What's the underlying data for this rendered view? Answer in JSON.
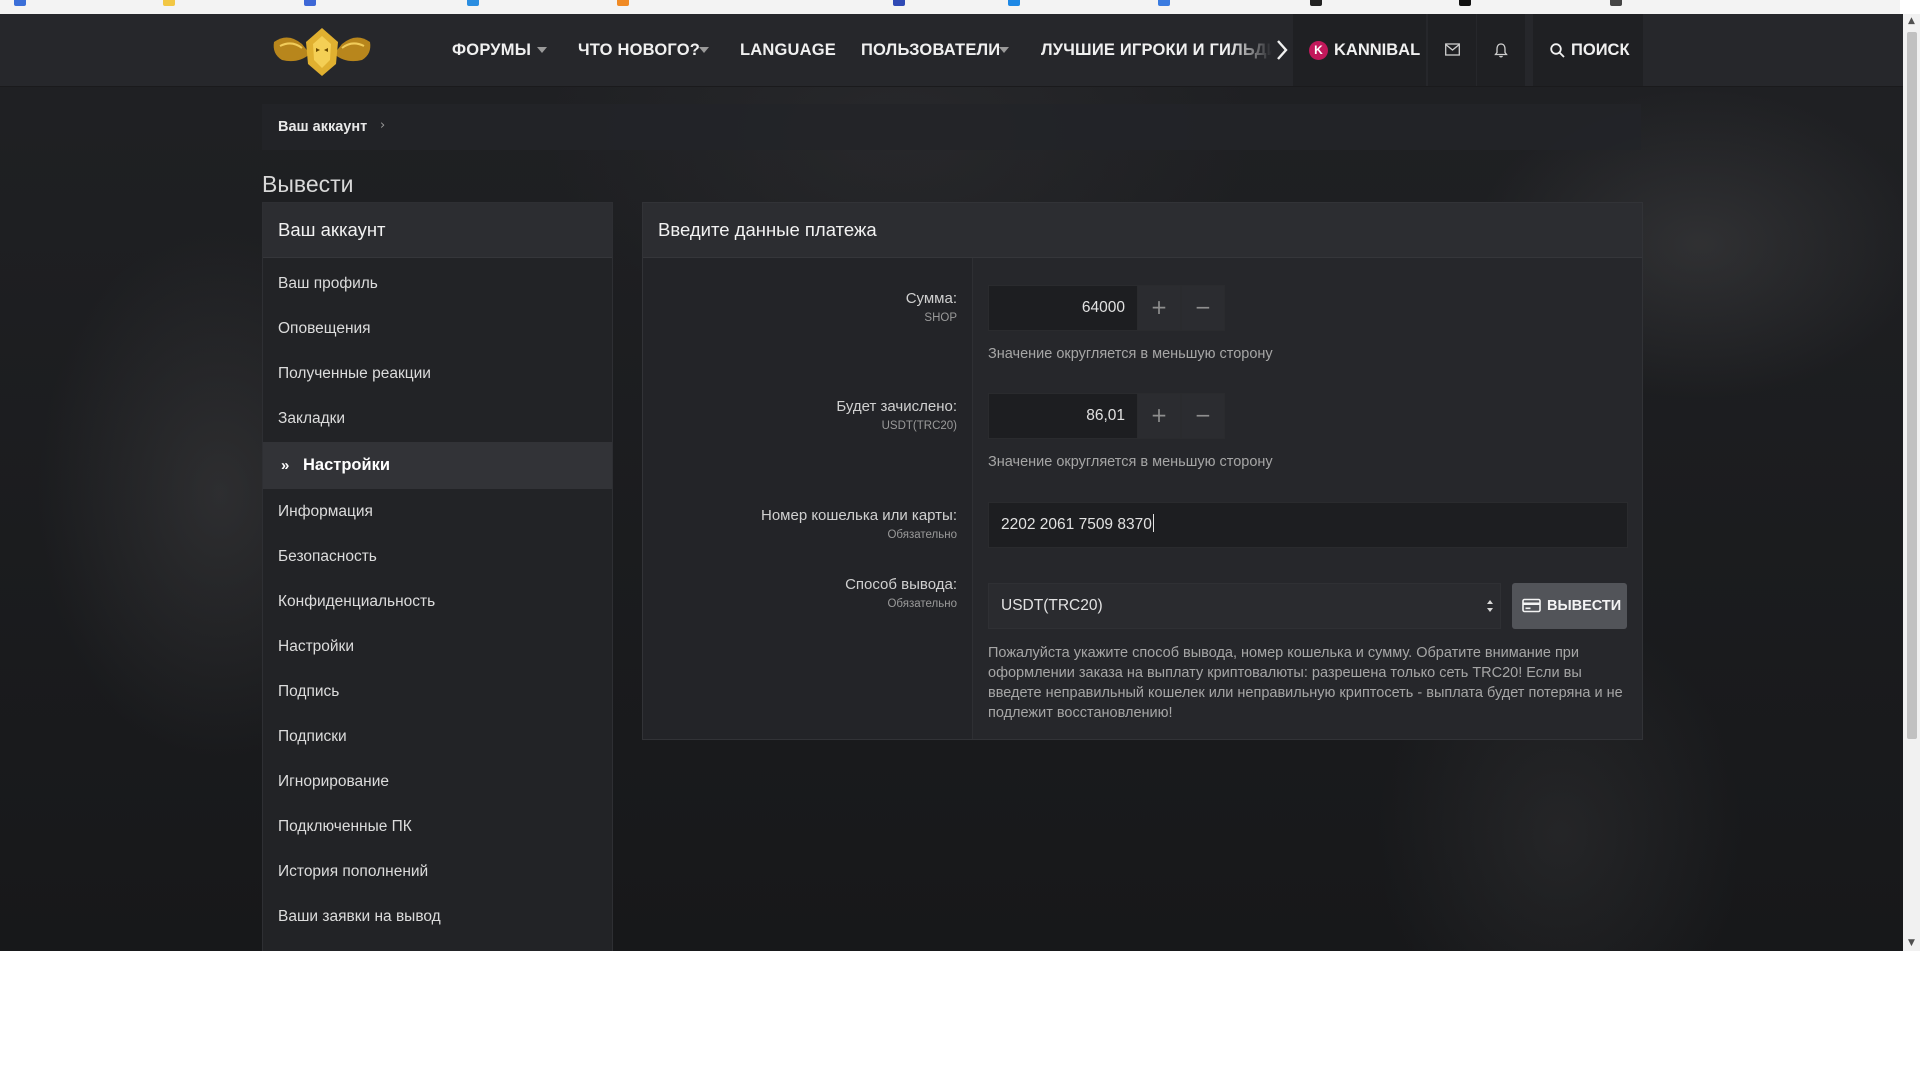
{
  "colors": {
    "navbar_bg": "#26272b",
    "page_bg": "#1b1c1f",
    "panel_bg": "#26272b",
    "accent_avatar": "#c2185b",
    "logo_gold": "#d4a82a"
  },
  "navbar": {
    "logo_icon": "guild-emblem-logo",
    "items": [
      {
        "label": "ФОРУМЫ",
        "has_dropdown": true
      },
      {
        "label": "ЧТО НОВОГО?",
        "has_dropdown": true
      },
      {
        "label": "LANGUAGE",
        "has_dropdown": false
      },
      {
        "label": "ПОЛЬЗОВАТЕЛИ",
        "has_dropdown": true
      },
      {
        "label": "ЛУЧШИЕ ИГРОКИ И ГИЛЬДИ",
        "has_dropdown": false
      }
    ],
    "user": {
      "avatar_letter": "K",
      "name": "KANNIBAL"
    },
    "icons": [
      "envelope-icon",
      "bell-icon"
    ],
    "search_label": "ПОИСК"
  },
  "breadcrumb": {
    "item": "Ваш аккаунт",
    "separator": "›"
  },
  "page_title": "Вывести",
  "sidebar": {
    "title": "Ваш аккаунт",
    "items": [
      {
        "label": "Ваш профиль",
        "active": false
      },
      {
        "label": "Оповещения",
        "active": false
      },
      {
        "label": "Полученные реакции",
        "active": false
      },
      {
        "label": "Закладки",
        "active": false
      },
      {
        "label": "Настройки",
        "active": true
      },
      {
        "label": "Информация",
        "active": false
      },
      {
        "label": "Безопасность",
        "active": false
      },
      {
        "label": "Конфиденциальность",
        "active": false
      },
      {
        "label": "Настройки",
        "active": false
      },
      {
        "label": "Подпись",
        "active": false
      },
      {
        "label": "Подписки",
        "active": false
      },
      {
        "label": "Игнорирование",
        "active": false
      },
      {
        "label": "Подключенные ПК",
        "active": false
      },
      {
        "label": "История пополнений",
        "active": false
      },
      {
        "label": "Ваши заявки на вывод",
        "active": false
      }
    ],
    "active_marker": "»"
  },
  "form": {
    "title": "Введите данные платежа",
    "amount": {
      "label": "Сумма:",
      "hint": "SHOP",
      "value": "64000",
      "explain": "Значение округляется в меньшую сторону"
    },
    "credited": {
      "label": "Будет зачислено:",
      "hint": "USDT(TRC20)",
      "value": "86,01",
      "explain": "Значение округляется в меньшую сторону"
    },
    "wallet": {
      "label": "Номер кошелька или карты:",
      "hint": "Обязательно",
      "value": "2202 2061 7509 8370"
    },
    "method": {
      "label": "Способ вывода:",
      "hint": "Обязательно",
      "selected": "USDT(TRC20)"
    },
    "stepper": {
      "plus": "+",
      "minus": "−"
    },
    "submit_label": "ВЫВЕСТИ",
    "notice": "Пожалуйста укажите способ вывода, номер кошелька и сумму. Обратите внимание при оформлении заказа на выплату криптовалюты: разрешена только сеть TRC20! Если вы введете неправильный кошелек или неправильную криптосеть - выплата будет потеряна и не подлежит восстановлению!"
  }
}
